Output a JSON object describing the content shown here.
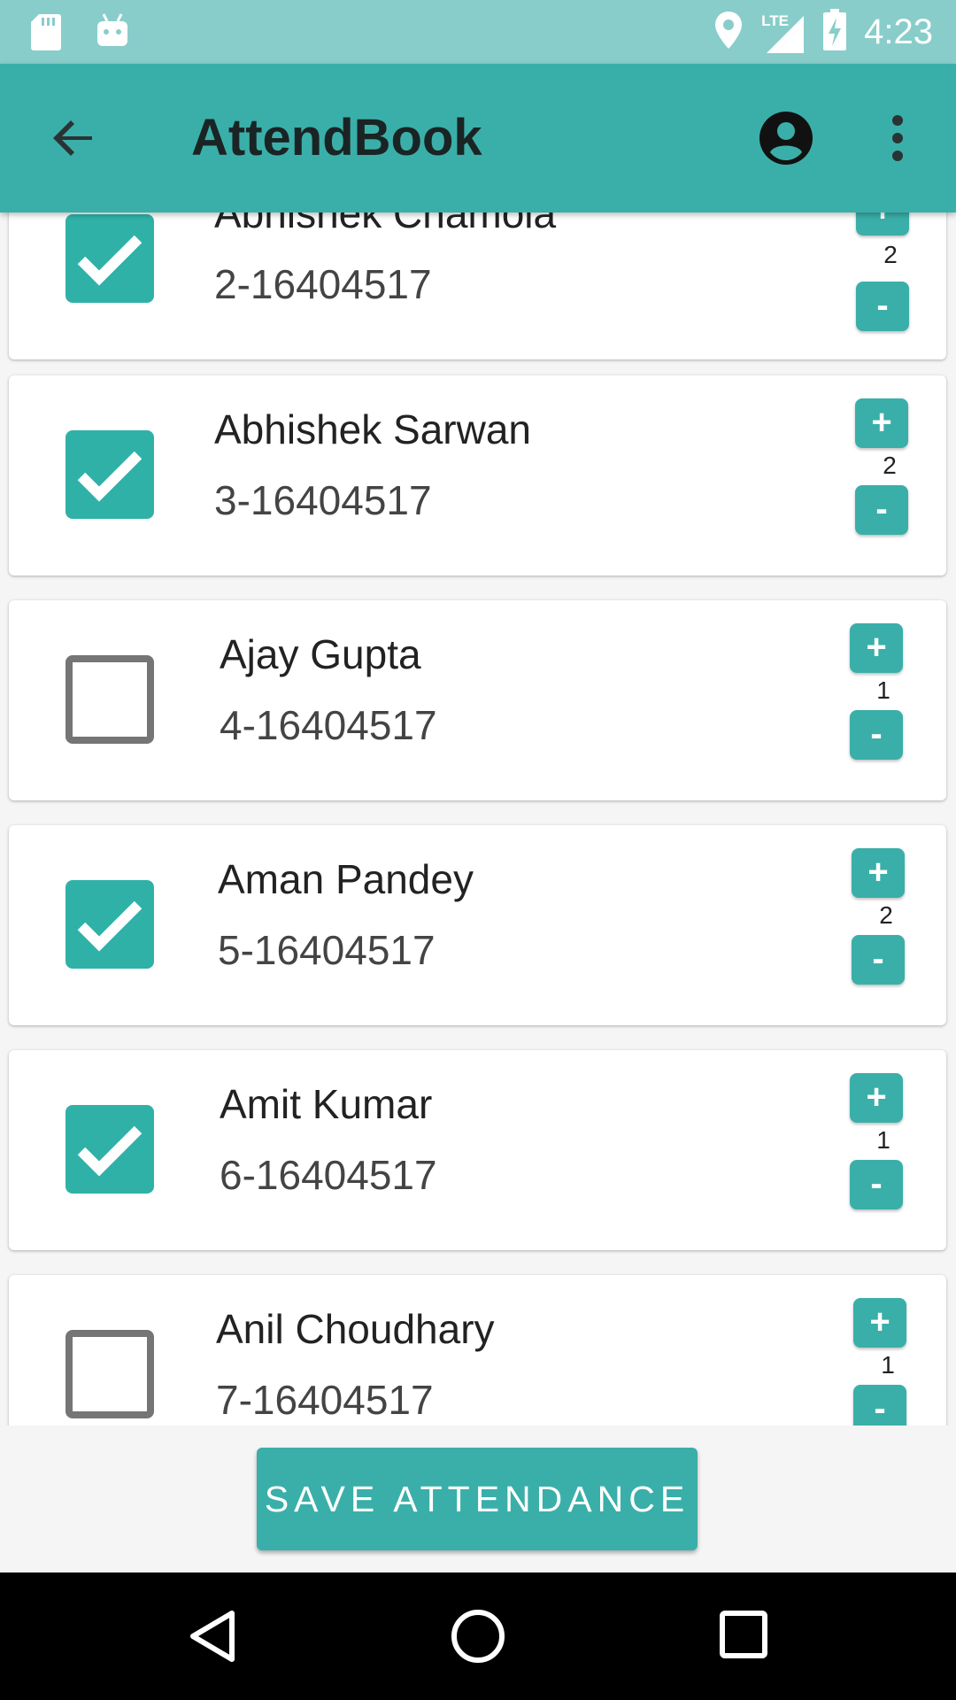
{
  "status_bar": {
    "time": "4:23",
    "network": "LTE",
    "icons": [
      "sd-card-icon",
      "android-icon",
      "location-icon",
      "signal-icon",
      "battery-charging-icon"
    ]
  },
  "app_bar": {
    "title": "AttendBook",
    "icons": [
      "back-arrow-icon",
      "account-icon",
      "more-vert-icon"
    ]
  },
  "students": [
    {
      "name": "Abhishek Chamola",
      "roll": "2-16404517",
      "checked": true,
      "count": "2",
      "plus": "+",
      "minus": "-"
    },
    {
      "name": "Abhishek Sarwan",
      "roll": "3-16404517",
      "checked": true,
      "count": "2",
      "plus": "+",
      "minus": "-"
    },
    {
      "name": "Ajay Gupta",
      "roll": "4-16404517",
      "checked": false,
      "count": "1",
      "plus": "+",
      "minus": "-"
    },
    {
      "name": "Aman Pandey",
      "roll": "5-16404517",
      "checked": true,
      "count": "2",
      "plus": "+",
      "minus": "-"
    },
    {
      "name": "Amit Kumar",
      "roll": "6-16404517",
      "checked": true,
      "count": "1",
      "plus": "+",
      "minus": "-"
    },
    {
      "name": "Anil Choudhary",
      "roll": "7-16404517",
      "checked": false,
      "count": "1",
      "plus": "+",
      "minus": "-"
    }
  ],
  "save_button": {
    "label": "SAVE ATTENDANCE"
  },
  "colors": {
    "accent": "#3aafa9",
    "status_bar": "#88cdca",
    "checkbox_on": "#2fb1a8"
  },
  "nav_bar": {
    "icons": [
      "back-triangle-icon",
      "home-circle-icon",
      "recents-square-icon"
    ]
  }
}
